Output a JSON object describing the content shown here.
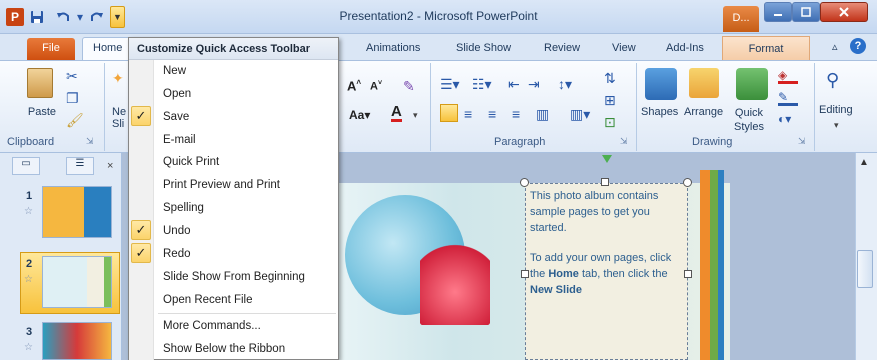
{
  "window": {
    "title": "Presentation2 - Microsoft PowerPoint",
    "context_tab": "D...",
    "app_icon": "P"
  },
  "icons": {
    "app": "powerpoint-icon",
    "save": "save-icon",
    "undo": "undo-icon",
    "redo": "redo-icon",
    "minimize": "minimize-icon",
    "maximize": "maximize-icon",
    "close": "close-icon",
    "help": "help-icon",
    "find": "binoculars-icon"
  },
  "tabs": {
    "file": "File",
    "home": "Home",
    "items": [
      "Animations",
      "Slide Show",
      "Review",
      "View",
      "Add-Ins"
    ],
    "format": "Format"
  },
  "ribbon": {
    "paste": "Paste",
    "new_slide": "Ne\nSli",
    "groups": {
      "clipboard": "Clipboard",
      "paragraph": "Paragraph",
      "drawing": "Drawing"
    },
    "shapes": "Shapes",
    "arrange": "Arrange",
    "quick_styles": "Quick\nStyles",
    "editing": "Editing"
  },
  "slides": {
    "numbers": [
      "1",
      "2",
      "3"
    ]
  },
  "textbox": {
    "para1": "This photo album contains sample pages to get you started.",
    "para2_pre": "To add your own pages, click the ",
    "para2_home": "Home",
    "para2_mid": " tab, then click the ",
    "para2_new": "New Slide"
  },
  "menu": {
    "header": "Customize Quick Access Toolbar",
    "items": [
      {
        "label": "New",
        "checked": false
      },
      {
        "label": "Open",
        "checked": false
      },
      {
        "label": "Save",
        "checked": true
      },
      {
        "label": "E-mail",
        "checked": false
      },
      {
        "label": "Quick Print",
        "checked": false
      },
      {
        "label": "Print Preview and Print",
        "checked": false
      },
      {
        "label": "Spelling",
        "checked": false
      },
      {
        "label": "Undo",
        "checked": true
      },
      {
        "label": "Redo",
        "checked": true
      },
      {
        "label": "Slide Show From Beginning",
        "checked": false
      },
      {
        "label": "Open Recent File",
        "checked": false
      },
      {
        "label": "More Commands...",
        "checked": false
      },
      {
        "label": "Show Below the Ribbon",
        "checked": false
      }
    ],
    "check_glyph": "✓"
  },
  "colors": {
    "file_tab": "#cf4f10",
    "ribbon_bg": "#dfe9f6",
    "accent": "#2a59a8",
    "check_bg": "#fbd36b"
  }
}
